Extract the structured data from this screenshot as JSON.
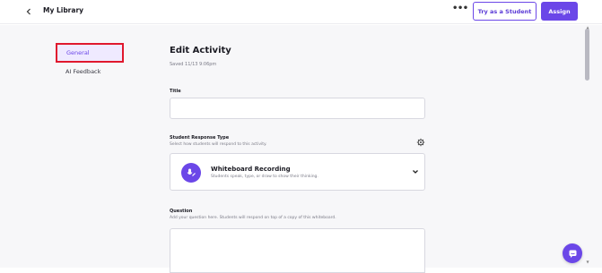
{
  "header": {
    "back_icon": "chevron-left-icon",
    "title": "My Library",
    "more_label": "•••",
    "try_label": "Try as a Student",
    "assign_label": "Assign"
  },
  "sidebar": {
    "items": [
      {
        "label": "General",
        "selected": true
      },
      {
        "label": "AI Feedback",
        "selected": false
      }
    ]
  },
  "main": {
    "heading": "Edit Activity",
    "saved_text": "Saved 11/13 9:06pm",
    "title_field": {
      "label": "Title",
      "value": "",
      "placeholder": ""
    },
    "response_type": {
      "label": "Student Response Type",
      "subtitle": "Select how students will respond to this activity.",
      "settings_icon": "gear-icon",
      "selected_title": "Whiteboard Recording",
      "selected_subtitle": "Students speak, type, or draw to show their thinking."
    },
    "question": {
      "label": "Question",
      "subtitle": "Add your question here. Students will respond on top of a copy of this whiteboard."
    }
  },
  "colors": {
    "accent": "#6b47e8",
    "highlight_border": "#e0182d",
    "selected_bg": "#efeaff",
    "page_bg": "#f7f7f9"
  }
}
